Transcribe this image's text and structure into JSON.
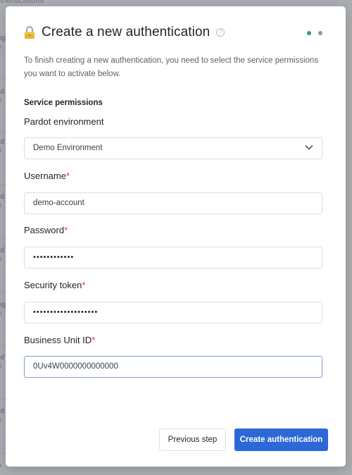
{
  "background": {
    "header_text": "uthentications",
    "fragments": [
      {
        "title": "ng",
        "sub": "a"
      },
      {
        "title": "rd",
        "sub": "a"
      },
      {
        "title": "rd",
        "sub": "a"
      },
      {
        "title": "rd",
        "sub": "a"
      },
      {
        "title": "rd",
        "sub": "a"
      },
      {
        "title": "ng",
        "sub": "a"
      },
      {
        "title": "rd",
        "sub": "a"
      },
      {
        "title": "rd",
        "sub": "a"
      },
      {
        "title": "v",
        "sub": ""
      }
    ]
  },
  "modal": {
    "title": "Create a new authentication",
    "lock_icon": "lock-icon",
    "help_icon": "?",
    "steps": [
      {
        "state": "active",
        "color": "#2f9e77"
      },
      {
        "state": "inactive",
        "color": "#8f959b"
      }
    ],
    "intro": "To finish creating a new authentication, you need to select the service permissions you want to activate below.",
    "section_label": "Service permissions",
    "fields": {
      "environment": {
        "label": "Pardot environment",
        "value": "Demo Environment"
      },
      "username": {
        "label": "Username",
        "required_mark": "*",
        "value": "demo-account"
      },
      "password": {
        "label": "Password",
        "required_mark": "*",
        "value": "••••••••••••"
      },
      "security_token": {
        "label": "Security token",
        "required_mark": "*",
        "value": "•••••••••••••••••••"
      },
      "business_unit": {
        "label": "Business Unit ID",
        "required_mark": "*",
        "value": "0Uv4W0000000000000"
      }
    },
    "buttons": {
      "previous": "Previous step",
      "create": "Create authentication"
    },
    "colors": {
      "primary": "#2c69d6",
      "required": "#d9363e",
      "focus_border": "#7d9ec9"
    }
  }
}
